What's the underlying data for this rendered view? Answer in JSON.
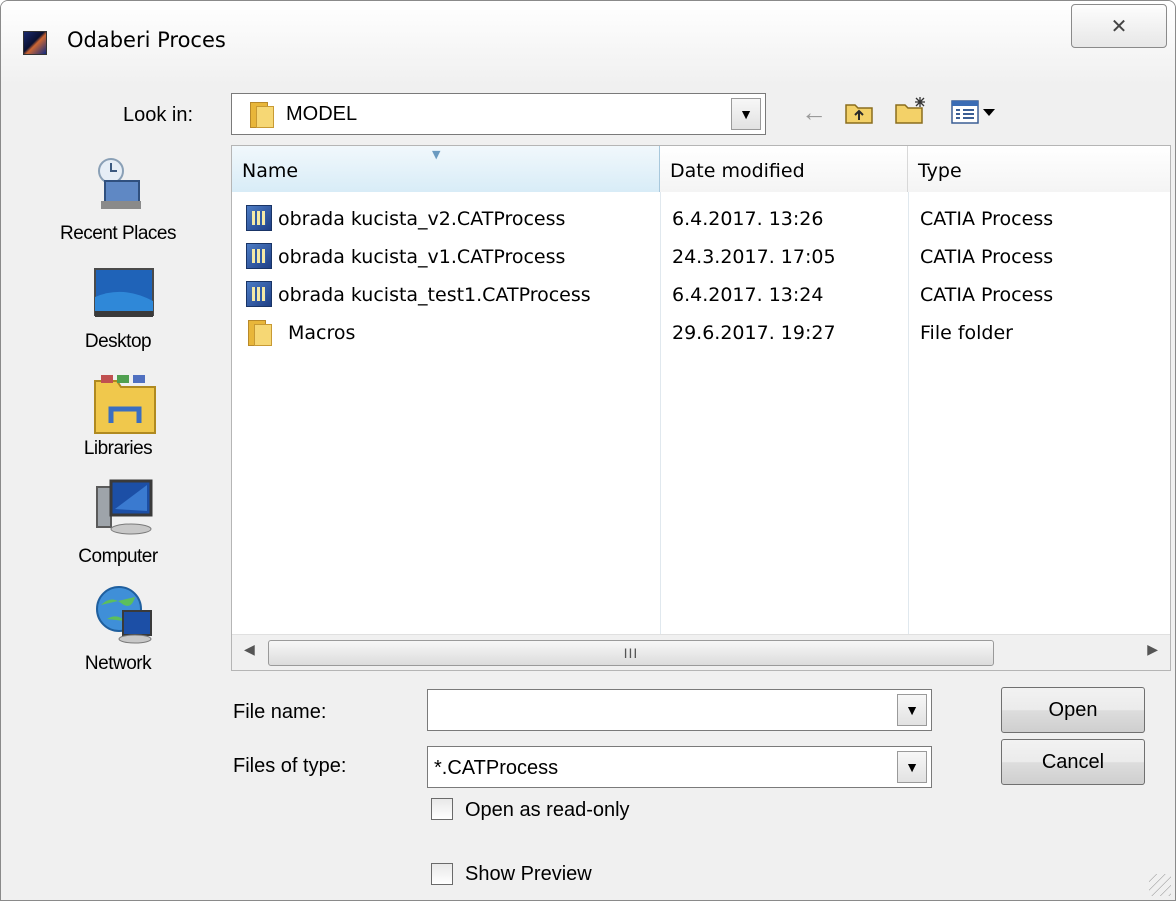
{
  "window": {
    "title": "Odaberi Proces",
    "close_glyph": "✕"
  },
  "toolbar": {
    "look_in_label": "Look in:",
    "look_in_value": "MODEL",
    "icons": [
      "back-arrow-icon",
      "up-folder-icon",
      "new-folder-icon",
      "view-menu-icon"
    ]
  },
  "places": [
    {
      "label": "Recent Places",
      "icon": "recent-places-icon"
    },
    {
      "label": "Desktop",
      "icon": "desktop-icon"
    },
    {
      "label": "Libraries",
      "icon": "libraries-icon"
    },
    {
      "label": "Computer",
      "icon": "computer-icon"
    },
    {
      "label": "Network",
      "icon": "network-icon"
    }
  ],
  "list": {
    "columns": [
      "Name",
      "Date modified",
      "Type"
    ],
    "rows": [
      {
        "name": "obrada kucista_v2.CATProcess",
        "date": "6.4.2017. 13:26",
        "type": "CATIA Process",
        "icon": "catprocess-file-icon"
      },
      {
        "name": "obrada kucista_v1.CATProcess",
        "date": "24.3.2017. 17:05",
        "type": "CATIA Process",
        "icon": "catprocess-file-icon"
      },
      {
        "name": "obrada kucista_test1.CATProcess",
        "date": "6.4.2017. 13:24",
        "type": "CATIA Process",
        "icon": "catprocess-file-icon"
      },
      {
        "name": "Macros",
        "date": "29.6.2017. 19:27",
        "type": "File folder",
        "icon": "folder-icon"
      }
    ],
    "scroll_thumb": "III"
  },
  "form": {
    "file_name_label": "File name:",
    "file_name_value": "",
    "files_of_type_label": "Files of type:",
    "files_of_type_value": "*.CATProcess",
    "open_readonly_label": "Open as read-only",
    "show_preview_label": "Show Preview",
    "open_button": "Open",
    "cancel_button": "Cancel"
  }
}
